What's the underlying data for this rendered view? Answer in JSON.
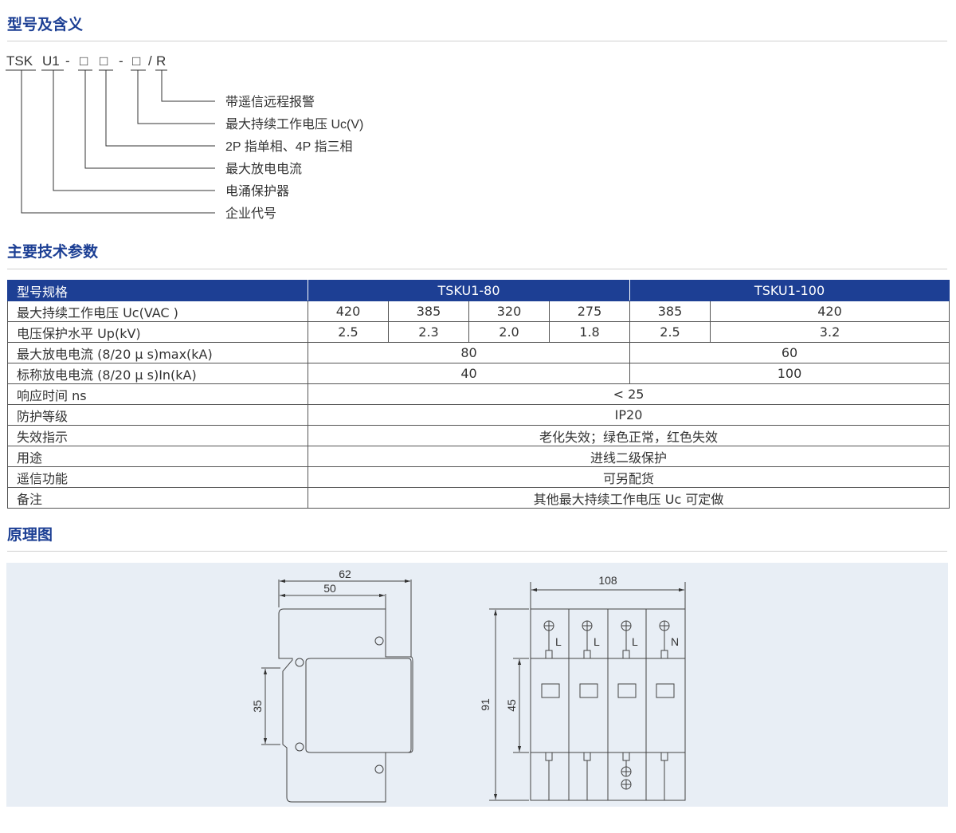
{
  "sections": {
    "model_meaning": "型号及含义",
    "specs": "主要技术参数",
    "schematic": "原理图"
  },
  "model_code": {
    "parts": [
      "TSK",
      "U1",
      "-",
      "□",
      "□",
      "-",
      "□",
      "/",
      "R"
    ],
    "explanations": [
      "带遥信远程报警",
      "最大持续工作电压 Uc(V)",
      "2P 指单相、4P 指三相",
      "最大放电电流",
      "电涌保护器",
      "企业代号"
    ]
  },
  "spec_table": {
    "header": {
      "label": "型号规格",
      "col1": "TSKU1-80",
      "col2": "TSKU1-100"
    },
    "rows": [
      {
        "label": "最大持续工作电压 Uc(VAC )",
        "values": [
          "420",
          "385",
          "320",
          "275",
          "385",
          "420"
        ]
      },
      {
        "label": "电压保护水平 Up(kV)",
        "values": [
          "2.5",
          "2.3",
          "2.0",
          "1.8",
          "2.5",
          "3.2"
        ]
      },
      {
        "label": "最大放电电流 (8/20 μ s)max(kA)",
        "values": [
          "80",
          "60"
        ]
      },
      {
        "label": "标称放电电流 (8/20 μ s)In(kA)",
        "values": [
          "40",
          "100"
        ]
      },
      {
        "label": "响应时间 ns",
        "values": [
          "< 25"
        ]
      },
      {
        "label": "防护等级",
        "values": [
          "IP20"
        ]
      },
      {
        "label": "失效指示",
        "values": [
          "老化失效；绿色正常，红色失效"
        ]
      },
      {
        "label": "用途",
        "values": [
          "进线二级保护"
        ]
      },
      {
        "label": "遥信功能",
        "values": [
          "可另配货"
        ]
      },
      {
        "label": "备注",
        "values": [
          "其他最大持续工作电压 Uc 可定做"
        ]
      }
    ]
  },
  "drawing": {
    "side": {
      "width_total": "62",
      "width_inner": "50",
      "rail": "35"
    },
    "front": {
      "width": "108",
      "height": "91",
      "window_height": "45",
      "terminals": [
        "L",
        "L",
        "L",
        "N"
      ]
    }
  }
}
